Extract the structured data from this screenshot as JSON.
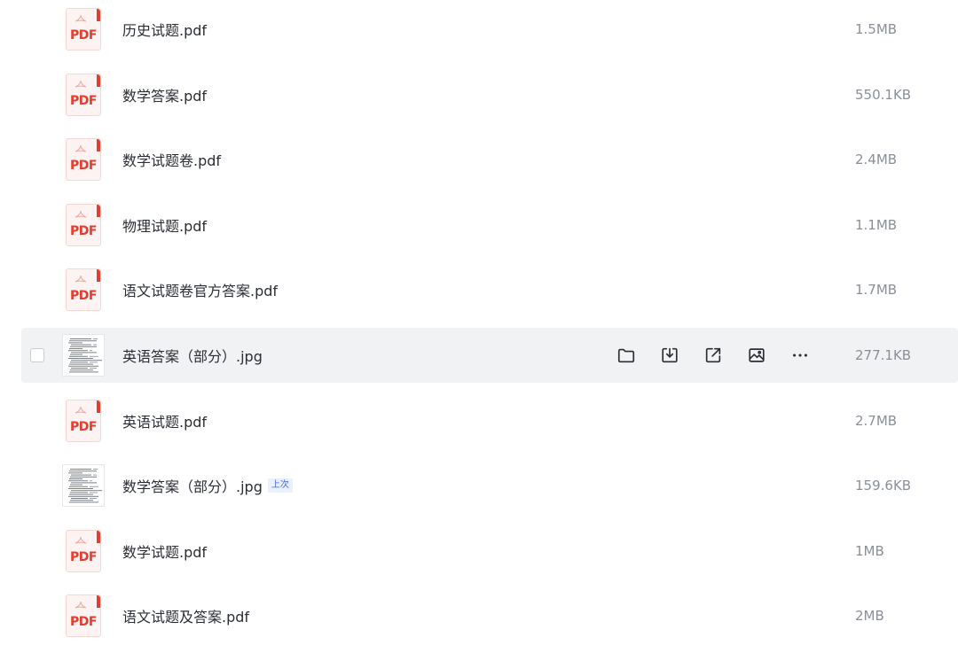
{
  "files": [
    {
      "name": "历史试题.pdf",
      "size": "1.5MB",
      "type": "pdf",
      "icon": "pdf-file-icon",
      "icon_label": "PDF"
    },
    {
      "name": "数学答案.pdf",
      "size": "550.1KB",
      "type": "pdf",
      "icon": "pdf-file-icon",
      "icon_label": "PDF"
    },
    {
      "name": "数学试题卷.pdf",
      "size": "2.4MB",
      "type": "pdf",
      "icon": "pdf-file-icon",
      "icon_label": "PDF"
    },
    {
      "name": "物理试题.pdf",
      "size": "1.1MB",
      "type": "pdf",
      "icon": "pdf-file-icon",
      "icon_label": "PDF"
    },
    {
      "name": "语文试题卷官方答案.pdf",
      "size": "1.7MB",
      "type": "pdf",
      "icon": "pdf-file-icon",
      "icon_label": "PDF"
    },
    {
      "name": "英语答案（部分）.jpg",
      "size": "277.1KB",
      "type": "jpg",
      "icon": "image-thumbnail",
      "selected": true
    },
    {
      "name": "英语试题.pdf",
      "size": "2.7MB",
      "type": "pdf",
      "icon": "pdf-file-icon",
      "icon_label": "PDF"
    },
    {
      "name": "数学答案（部分）.jpg",
      "size": "159.6KB",
      "type": "jpg",
      "icon": "image-thumbnail",
      "tag": "上次"
    },
    {
      "name": "数学试题.pdf",
      "size": "1MB",
      "type": "pdf",
      "icon": "pdf-file-icon",
      "icon_label": "PDF"
    },
    {
      "name": "语文试题及答案.pdf",
      "size": "2MB",
      "type": "pdf",
      "icon": "pdf-file-icon",
      "icon_label": "PDF"
    }
  ],
  "row_actions": [
    {
      "icon": "folder-icon"
    },
    {
      "icon": "download-icon"
    },
    {
      "icon": "share-icon"
    },
    {
      "icon": "image-preview-icon"
    },
    {
      "icon": "more-icon"
    }
  ],
  "colors": {
    "pdf_red": "#e23d2f",
    "text": "#2a2d33",
    "size_text": "#8a8f99",
    "selected_bg": "#f1f2f4",
    "tag_blue": "#3b6ee8"
  }
}
